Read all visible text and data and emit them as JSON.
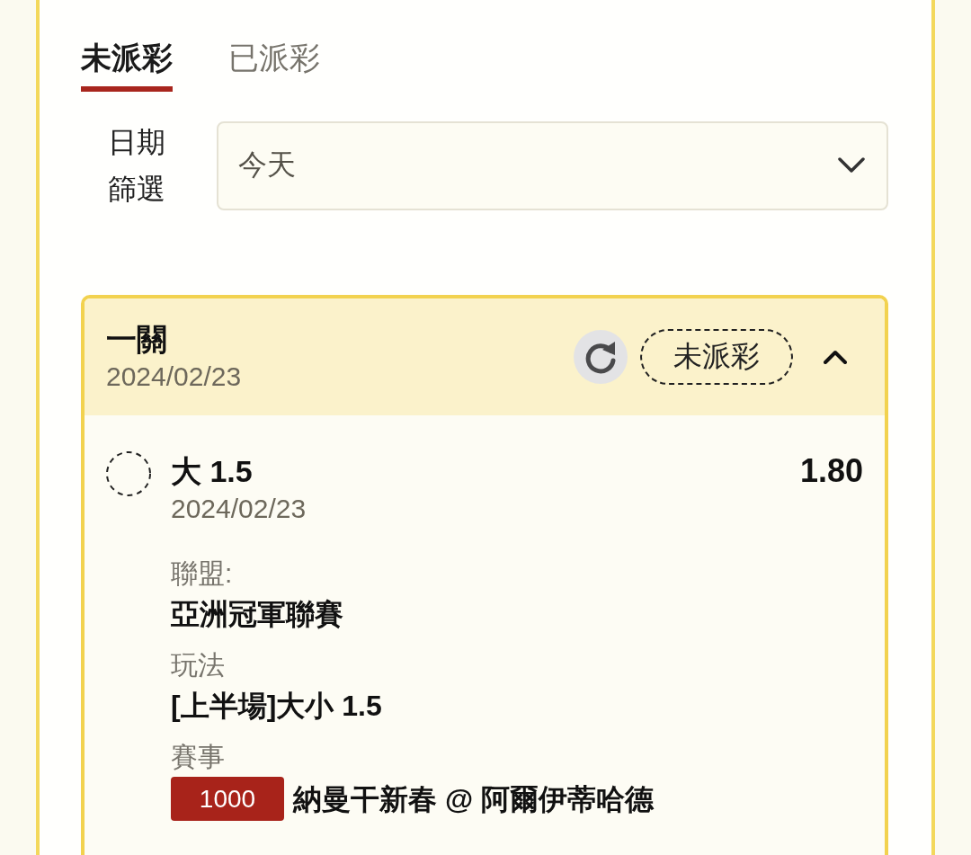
{
  "tabs": [
    {
      "label": "未派彩",
      "selected": true
    },
    {
      "label": "已派彩",
      "selected": false
    }
  ],
  "date_filter": {
    "label": "日期篩選",
    "value": "今天"
  },
  "bet_card": {
    "title": "一關",
    "date": "2024/02/23",
    "status": "未派彩",
    "expanded": true,
    "selections": [
      {
        "settled": false,
        "selection": "大 1.5",
        "date": "2024/02/23",
        "odds": "1.80",
        "details": [
          {
            "label": "聯盟:",
            "value": "亞洲冠軍聯賽"
          },
          {
            "label": "玩法",
            "value": "[上半場]大小 1.5"
          },
          {
            "label": "賽事",
            "code": "1000",
            "value": "納曼干新春 @ 阿爾伊蒂哈德"
          }
        ]
      }
    ]
  }
}
